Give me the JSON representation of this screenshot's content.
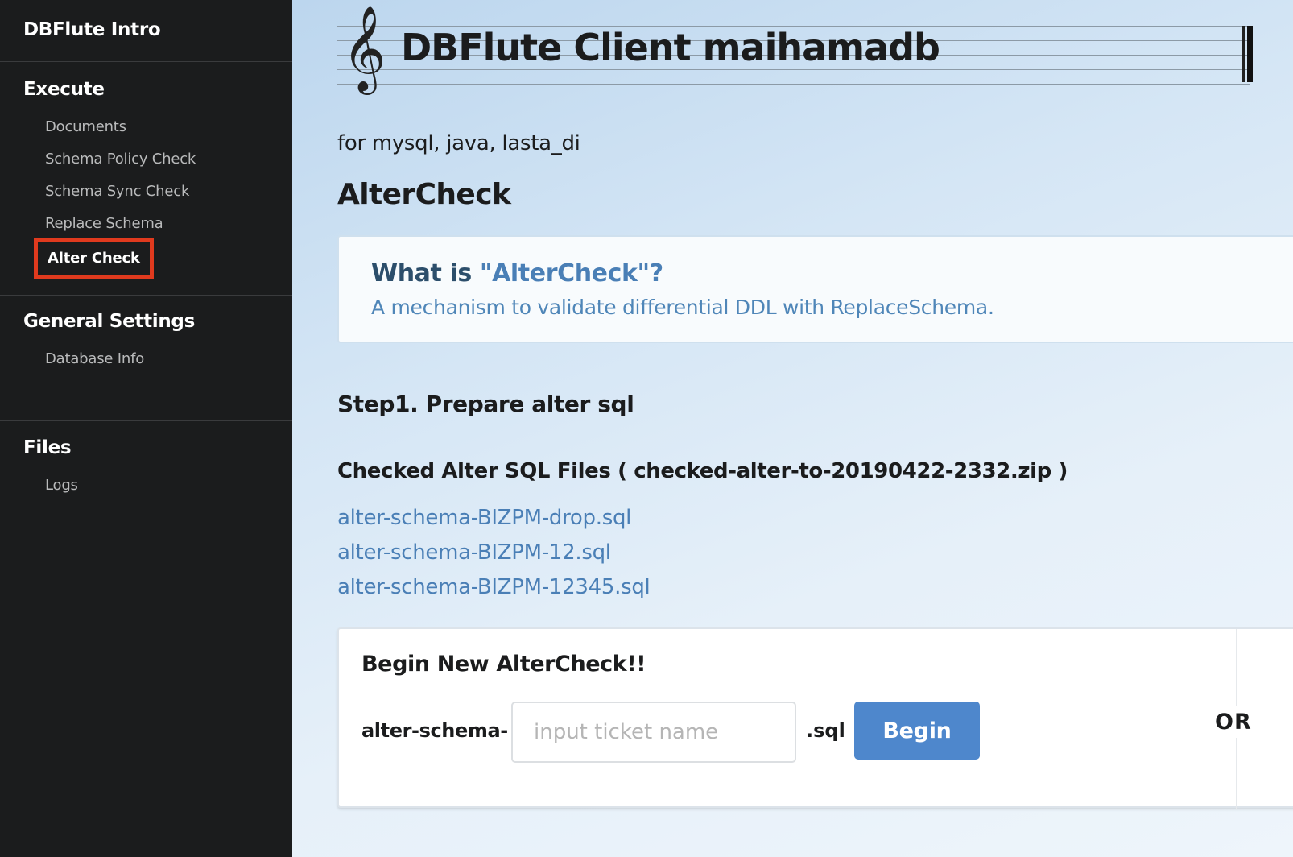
{
  "sidebar": {
    "app_title": "DBFlute Intro",
    "sections": {
      "execute": {
        "header": "Execute",
        "items": [
          "Documents",
          "Schema Policy Check",
          "Schema Sync Check",
          "Replace Schema",
          "Alter Check"
        ],
        "active_item": "Alter Check"
      },
      "general": {
        "header": "General Settings",
        "items": [
          "Database Info"
        ]
      },
      "files": {
        "header": "Files",
        "items": [
          "Logs"
        ]
      }
    },
    "highlight_color": "#e03a1e"
  },
  "main": {
    "page_title": "DBFlute Client maihamadb",
    "subtitle": "for mysql, java, lasta_di",
    "section_title": "AlterCheck",
    "info": {
      "question_prefix": "What is ",
      "question_highlight": "\"AlterCheck\"?",
      "answer": "A mechanism to validate differential DDL with ReplaceSchema."
    },
    "step1_title": "Step1. Prepare alter sql",
    "checked_files_title": "Checked Alter SQL Files ( checked-alter-to-20190422-2332.zip )",
    "files": [
      "alter-schema-BIZPM-drop.sql",
      "alter-schema-BIZPM-12.sql",
      "alter-schema-BIZPM-12345.sql"
    ],
    "begin_form": {
      "title": "Begin New AlterCheck!!",
      "prefix": "alter-schema-",
      "placeholder": "input ticket name",
      "suffix": ".sql",
      "button_label": "Begin",
      "or_label": "OR"
    },
    "accent_color": "#4e87cc",
    "link_color": "#4a7fb6"
  }
}
